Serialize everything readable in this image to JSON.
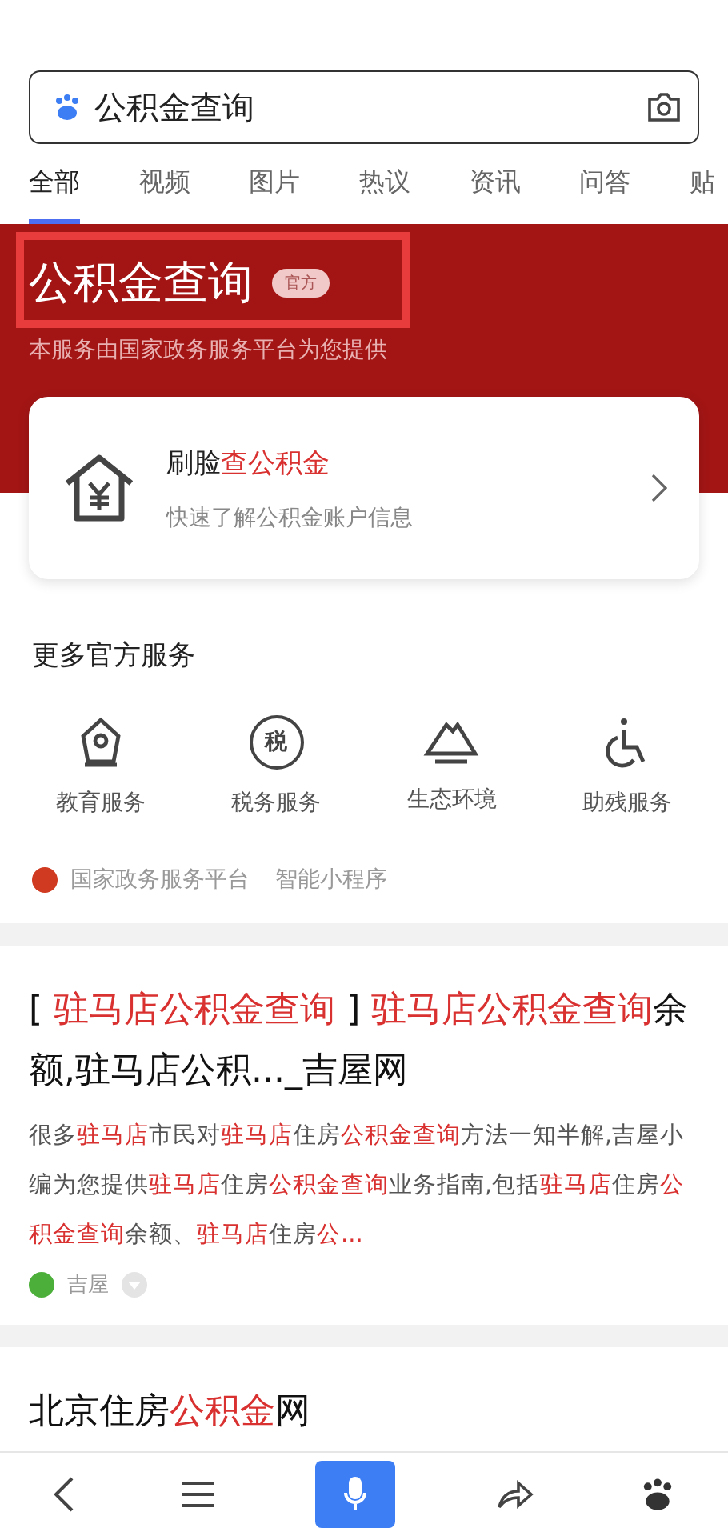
{
  "search": {
    "value": "公积金查询"
  },
  "tabs": [
    {
      "label": "全部",
      "selected": true
    },
    {
      "label": "视频",
      "selected": false
    },
    {
      "label": "图片",
      "selected": false
    },
    {
      "label": "热议",
      "selected": false
    },
    {
      "label": "资讯",
      "selected": false
    },
    {
      "label": "问答",
      "selected": false
    },
    {
      "label": "贴",
      "selected": false
    }
  ],
  "header": {
    "title": "公积金查询",
    "badge": "官方",
    "subtitle": "本服务由国家政务服务平台为您提供",
    "highlighted": true
  },
  "feature_card": {
    "title": [
      {
        "text": "刷脸",
        "hl": false
      },
      {
        "text": "查公积金",
        "hl": true
      }
    ],
    "description": "快速了解公积金账户信息"
  },
  "services": {
    "title": "更多官方服务",
    "items": [
      {
        "kind": "education",
        "label": "教育服务"
      },
      {
        "kind": "tax",
        "label": "税务服务",
        "icon_text": "税"
      },
      {
        "kind": "ecology",
        "label": "生态环境"
      },
      {
        "kind": "accessibility",
        "label": "助残服务"
      }
    ],
    "platform": "国家政务服务平台",
    "platform_type": "智能小程序"
  },
  "results": [
    {
      "title": [
        {
          "text": "[ ",
          "hl": false
        },
        {
          "text": "驻马店公积金查询",
          "hl": true
        },
        {
          "text": " ] ",
          "hl": false
        },
        {
          "text": "驻马店公积金查询",
          "hl": true
        },
        {
          "text": "余额,驻马店公积..._吉屋网",
          "hl": false
        }
      ],
      "snippet": [
        {
          "text": "很多",
          "hl": false
        },
        {
          "text": "驻马店",
          "hl": true
        },
        {
          "text": "市民对",
          "hl": false
        },
        {
          "text": "驻马店",
          "hl": true
        },
        {
          "text": "住房",
          "hl": false
        },
        {
          "text": "公积金查询",
          "hl": true
        },
        {
          "text": "方法一知半解,吉屋小编为您提供",
          "hl": false
        },
        {
          "text": "驻马店",
          "hl": true
        },
        {
          "text": "住房",
          "hl": false
        },
        {
          "text": "公积金查询",
          "hl": true
        },
        {
          "text": "业务指南,包括",
          "hl": false
        },
        {
          "text": "驻马店",
          "hl": true
        },
        {
          "text": "住房",
          "hl": false
        },
        {
          "text": "公积金查询",
          "hl": true
        },
        {
          "text": "余额、",
          "hl": false
        },
        {
          "text": "驻马店",
          "hl": true
        },
        {
          "text": "住房",
          "hl": false
        },
        {
          "text": "公...",
          "hl": true
        }
      ],
      "source": "吉屋"
    },
    {
      "title": [
        {
          "text": "北京住房",
          "hl": false
        },
        {
          "text": "公积金",
          "hl": true
        },
        {
          "text": "网",
          "hl": false
        }
      ]
    }
  ]
}
